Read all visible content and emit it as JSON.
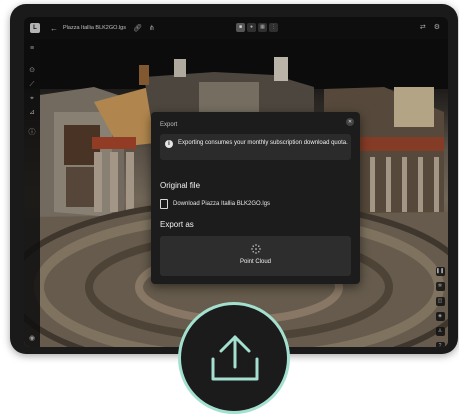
{
  "toolbar": {
    "back_icon": "back-arrow-icon",
    "filename": "Plazza Itallia BLK2GO.lgs",
    "share_icon": "share-icon",
    "link_icon": "link-icon",
    "view_tools": [
      "square-view-icon",
      "dot-view-icon",
      "grid-view-icon",
      "more-icon"
    ],
    "right_icons": [
      "expand-icon",
      "settings-icon"
    ]
  },
  "left_rail": {
    "icons": [
      "layers-icon",
      "target-icon",
      "measure-icon",
      "pin-icon",
      "filter-icon",
      "info-icon"
    ]
  },
  "right_rail": {
    "icons": [
      "pause-icon",
      "gear-icon",
      "camera-icon",
      "compass-icon",
      "person-icon",
      "help-icon"
    ]
  },
  "modal": {
    "title": "Export",
    "notice": "Exporting consumes your monthly subscription download quota.",
    "original_file_heading": "Original file",
    "original_file_link": "Download Piazza Itallia BLK2GO.lgs",
    "export_as_heading": "Export as",
    "option_label": "Point Cloud"
  },
  "colors": {
    "modal_bg": "#1c1c1c",
    "badge_ring": "#a4e0cf",
    "badge_bg": "#1b1b1b"
  }
}
